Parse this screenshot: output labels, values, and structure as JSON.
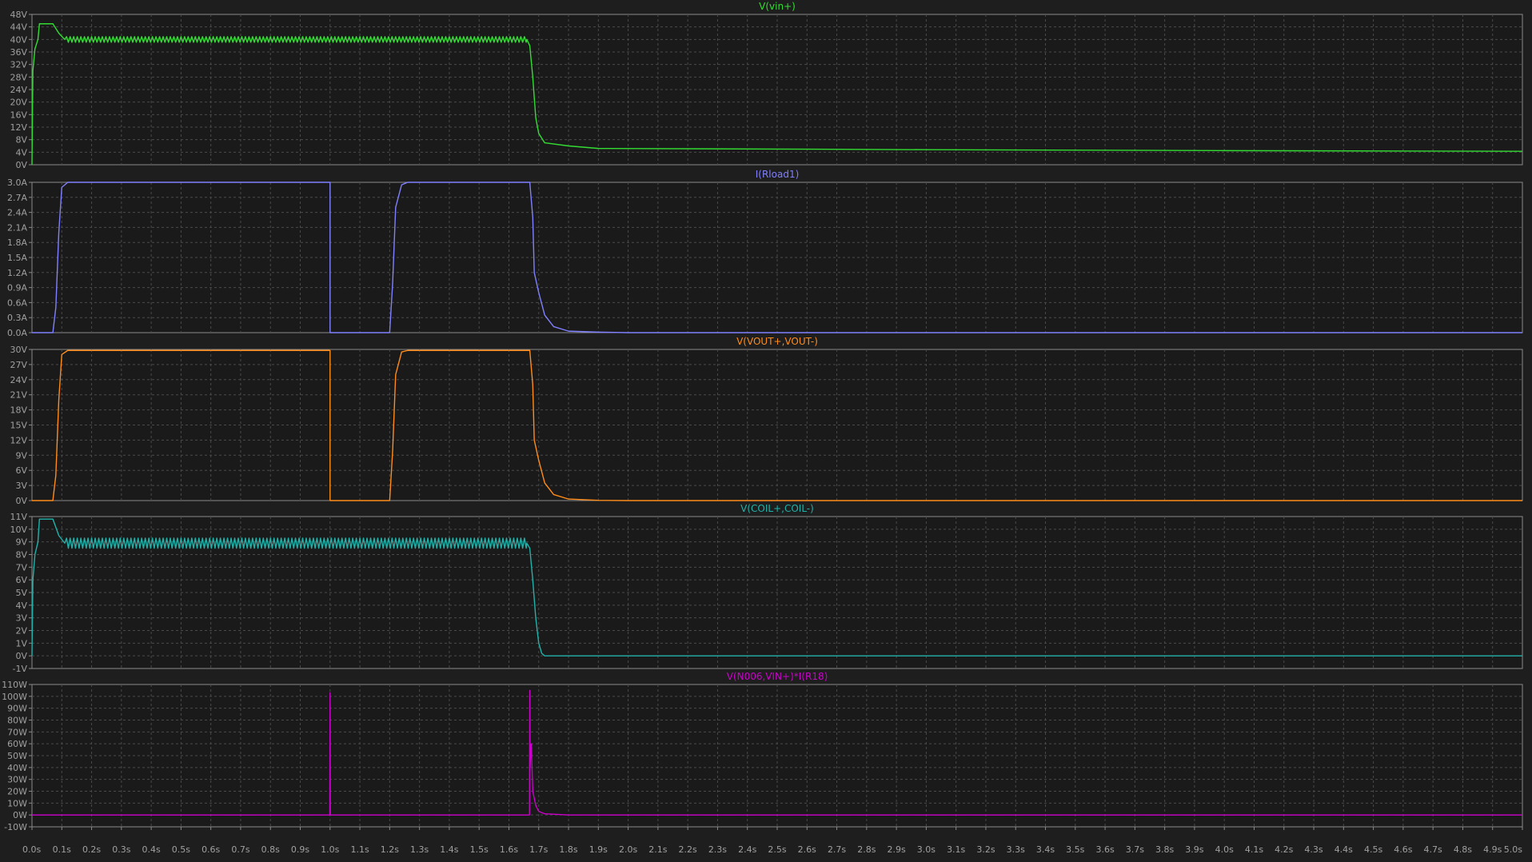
{
  "x_axis": {
    "ticks": [
      "0.0s",
      "0.1s",
      "0.2s",
      "0.3s",
      "0.4s",
      "0.5s",
      "0.6s",
      "0.7s",
      "0.8s",
      "0.9s",
      "1.0s",
      "1.1s",
      "1.2s",
      "1.3s",
      "1.4s",
      "1.5s",
      "1.6s",
      "1.7s",
      "1.8s",
      "1.9s",
      "2.0s",
      "2.1s",
      "2.2s",
      "2.3s",
      "2.4s",
      "2.5s",
      "2.6s",
      "2.7s",
      "2.8s",
      "2.9s",
      "3.0s",
      "3.1s",
      "3.2s",
      "3.3s",
      "3.4s",
      "3.5s",
      "3.6s",
      "3.7s",
      "3.8s",
      "3.9s",
      "4.0s",
      "4.1s",
      "4.2s",
      "4.3s",
      "4.4s",
      "4.5s",
      "4.6s",
      "4.7s",
      "4.8s",
      "4.9s",
      "5.0s"
    ]
  },
  "chart_data": [
    {
      "type": "line",
      "title": "V(vin+)",
      "color": "#33dd33",
      "xlim": [
        0,
        5
      ],
      "ylim": [
        0,
        48
      ],
      "yticks": [
        "0V",
        "4V",
        "8V",
        "12V",
        "16V",
        "20V",
        "24V",
        "28V",
        "32V",
        "36V",
        "40V",
        "44V",
        "48V"
      ],
      "grid": true,
      "series": [
        {
          "ripple": {
            "from": 0.1,
            "to": 1.67,
            "amplitude": 0.9,
            "period": 0.012
          },
          "points": [
            [
              0,
              0
            ],
            [
              0.003,
              30
            ],
            [
              0.01,
              37
            ],
            [
              0.02,
              40
            ],
            [
              0.025,
              45
            ],
            [
              0.07,
              45
            ],
            [
              0.09,
              42
            ],
            [
              0.11,
              40
            ],
            [
              1.66,
              40
            ],
            [
              1.67,
              38
            ],
            [
              1.68,
              28
            ],
            [
              1.69,
              15
            ],
            [
              1.7,
              10
            ],
            [
              1.72,
              7
            ],
            [
              1.8,
              6
            ],
            [
              1.9,
              5.2
            ],
            [
              2.5,
              5
            ],
            [
              3,
              4.8
            ],
            [
              4,
              4.5
            ],
            [
              5,
              4.3
            ]
          ]
        }
      ]
    },
    {
      "type": "line",
      "title": "I(Rload1)",
      "color": "#8080ff",
      "xlim": [
        0,
        5
      ],
      "ylim": [
        0,
        3.0
      ],
      "yticks": [
        "0.0A",
        "0.3A",
        "0.6A",
        "0.9A",
        "1.2A",
        "1.5A",
        "1.8A",
        "2.1A",
        "2.4A",
        "2.7A",
        "3.0A"
      ],
      "grid": true,
      "series": [
        {
          "points": [
            [
              0,
              0
            ],
            [
              0.07,
              0
            ],
            [
              0.08,
              0.5
            ],
            [
              0.09,
              2
            ],
            [
              0.1,
              2.9
            ],
            [
              0.12,
              3
            ],
            [
              1.0,
              3
            ],
            [
              1.0,
              0
            ],
            [
              1.2,
              0
            ],
            [
              1.21,
              1
            ],
            [
              1.22,
              2.5
            ],
            [
              1.24,
              2.95
            ],
            [
              1.26,
              3
            ],
            [
              1.67,
              3
            ],
            [
              1.68,
              2.3
            ],
            [
              1.685,
              1.2
            ],
            [
              1.7,
              0.8
            ],
            [
              1.72,
              0.35
            ],
            [
              1.75,
              0.12
            ],
            [
              1.8,
              0.03
            ],
            [
              1.9,
              0.01
            ],
            [
              2,
              0
            ],
            [
              5,
              0
            ]
          ]
        }
      ]
    },
    {
      "type": "line",
      "title": "V(VOUT+,VOUT-)",
      "color": "#ff8c1a",
      "xlim": [
        0,
        5
      ],
      "ylim": [
        0,
        30
      ],
      "yticks": [
        "0V",
        "3V",
        "6V",
        "9V",
        "12V",
        "15V",
        "18V",
        "21V",
        "24V",
        "27V",
        "30V"
      ],
      "grid": true,
      "series": [
        {
          "points": [
            [
              0,
              0
            ],
            [
              0.07,
              0
            ],
            [
              0.08,
              5
            ],
            [
              0.09,
              20
            ],
            [
              0.1,
              29
            ],
            [
              0.12,
              29.8
            ],
            [
              1.0,
              29.8
            ],
            [
              1.0,
              0
            ],
            [
              1.2,
              0
            ],
            [
              1.21,
              10
            ],
            [
              1.22,
              25
            ],
            [
              1.24,
              29.5
            ],
            [
              1.26,
              29.8
            ],
            [
              1.67,
              29.8
            ],
            [
              1.68,
              23
            ],
            [
              1.685,
              12
            ],
            [
              1.7,
              8
            ],
            [
              1.72,
              3.5
            ],
            [
              1.75,
              1.2
            ],
            [
              1.8,
              0.3
            ],
            [
              1.9,
              0.05
            ],
            [
              2,
              0
            ],
            [
              5,
              0
            ]
          ]
        }
      ]
    },
    {
      "type": "line",
      "title": "V(COIL+,COIL-)",
      "color": "#20b2aa",
      "xlim": [
        0,
        5
      ],
      "ylim": [
        -1,
        11
      ],
      "yticks": [
        "-1V",
        "0V",
        "1V",
        "2V",
        "3V",
        "4V",
        "5V",
        "6V",
        "7V",
        "8V",
        "9V",
        "10V",
        "11V"
      ],
      "grid": true,
      "series": [
        {
          "ripple": {
            "from": 0.11,
            "to": 1.67,
            "amplitude": 0.4,
            "period": 0.012
          },
          "points": [
            [
              0,
              0
            ],
            [
              0.003,
              6
            ],
            [
              0.01,
              8
            ],
            [
              0.02,
              9
            ],
            [
              0.025,
              10.8
            ],
            [
              0.07,
              10.8
            ],
            [
              0.09,
              9.5
            ],
            [
              0.11,
              8.9
            ],
            [
              1.66,
              8.9
            ],
            [
              1.67,
              8.5
            ],
            [
              1.68,
              6
            ],
            [
              1.69,
              3
            ],
            [
              1.7,
              1
            ],
            [
              1.71,
              0.2
            ],
            [
              1.72,
              0
            ],
            [
              5,
              0
            ]
          ]
        }
      ]
    },
    {
      "type": "line",
      "title": "V(N006,VIN+)*I(R18)",
      "color": "#cc00cc",
      "xlim": [
        0,
        5
      ],
      "ylim": [
        -10,
        110
      ],
      "yticks": [
        "-10W",
        "0W",
        "10W",
        "20W",
        "30W",
        "40W",
        "50W",
        "60W",
        "70W",
        "80W",
        "90W",
        "100W",
        "110W"
      ],
      "grid": true,
      "series": [
        {
          "points": [
            [
              0,
              0
            ],
            [
              0.999,
              0
            ],
            [
              1.0,
              103
            ],
            [
              1.001,
              0
            ],
            [
              1.669,
              0
            ],
            [
              1.67,
              105
            ],
            [
              1.671,
              40
            ],
            [
              1.675,
              60
            ],
            [
              1.68,
              20
            ],
            [
              1.69,
              8
            ],
            [
              1.7,
              3
            ],
            [
              1.72,
              1
            ],
            [
              1.8,
              0
            ],
            [
              5,
              0
            ]
          ]
        }
      ]
    }
  ]
}
